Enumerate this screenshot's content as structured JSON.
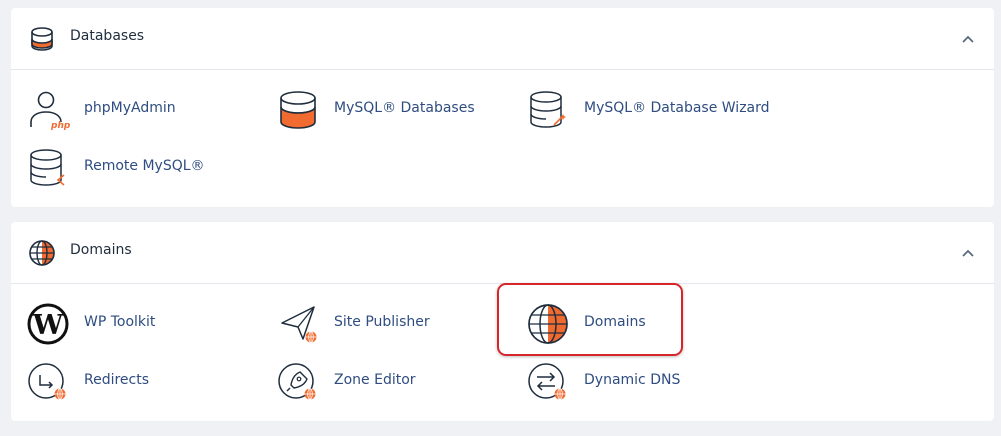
{
  "colors": {
    "accent": "#f16a2f",
    "link": "#2f4d80",
    "highlight": "#d6262b",
    "background": "#eff1f4"
  },
  "databases": {
    "title": "Databases",
    "header_icon": "database-icon",
    "collapse_icon": "chevron-up-icon",
    "items": [
      {
        "label": "phpMyAdmin",
        "icon": "phpmyadmin-icon"
      },
      {
        "label": "MySQL® Databases",
        "icon": "mysql-databases-icon"
      },
      {
        "label": "MySQL® Database Wizard",
        "icon": "mysql-wizard-icon"
      },
      {
        "label": "Remote MySQL®",
        "icon": "remote-mysql-icon"
      }
    ]
  },
  "domains": {
    "title": "Domains",
    "header_icon": "globe-icon",
    "collapse_icon": "chevron-up-icon",
    "items": [
      {
        "label": "WP Toolkit",
        "icon": "wordpress-icon"
      },
      {
        "label": "Site Publisher",
        "icon": "site-publisher-icon"
      },
      {
        "label": "Domains",
        "icon": "domains-globe-icon",
        "highlighted": true
      },
      {
        "label": "Redirects",
        "icon": "redirects-icon"
      },
      {
        "label": "Zone Editor",
        "icon": "zone-editor-icon"
      },
      {
        "label": "Dynamic DNS",
        "icon": "dynamic-dns-icon"
      }
    ]
  }
}
